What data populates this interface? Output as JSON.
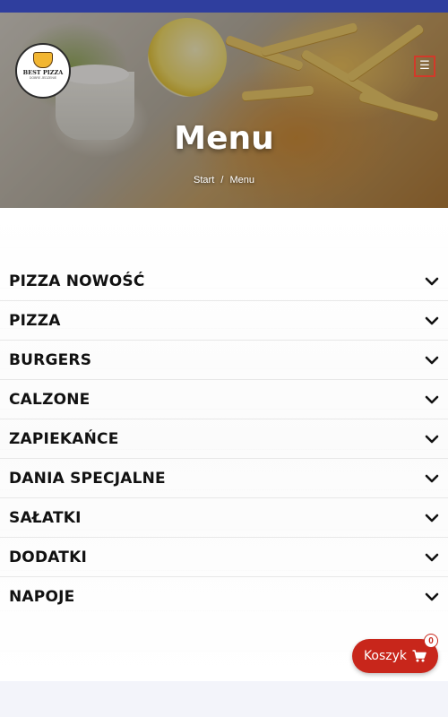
{
  "logo": {
    "name": "BEST PIZZA",
    "tagline": "DOBRE JEDZENIE"
  },
  "page": {
    "title": "Menu"
  },
  "breadcrumb": {
    "home": "Start",
    "separator": "/",
    "current": "Menu"
  },
  "menu": {
    "categories": [
      {
        "label": "PIZZA NOWOŚĆ"
      },
      {
        "label": "PIZZA"
      },
      {
        "label": "BURGERS"
      },
      {
        "label": "CALZONE"
      },
      {
        "label": "ZAPIEKAŃCE"
      },
      {
        "label": "DANIA SPECJALNE"
      },
      {
        "label": "SAŁATKI"
      },
      {
        "label": "DODATKI"
      },
      {
        "label": "NAPOJE"
      }
    ]
  },
  "cart": {
    "label": "Koszyk",
    "count": "0"
  },
  "icons": {
    "menu": "hamburger-menu-icon",
    "chevron": "chevron-down-icon",
    "cart": "shopping-cart-icon"
  },
  "colors": {
    "accent": "#c8261b",
    "header_bar": "#2f3e9e"
  }
}
